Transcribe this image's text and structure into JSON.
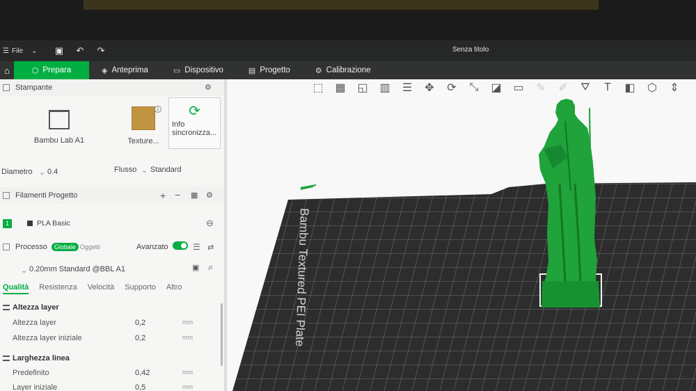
{
  "titlebar": {
    "file_menu": "File",
    "window_title": "Senza titolo"
  },
  "tabs": [
    {
      "label": "Prepara",
      "icon": "cube-icon",
      "active": true
    },
    {
      "label": "Anteprima",
      "icon": "layers-icon",
      "active": false
    },
    {
      "label": "Dispositivo",
      "icon": "monitor-icon",
      "active": false
    },
    {
      "label": "Progetto",
      "icon": "project-icon",
      "active": false
    },
    {
      "label": "Calibrazione",
      "icon": "gear-icon",
      "active": false
    }
  ],
  "printer": {
    "section_title": "Stampante",
    "printer_name": "Bambu Lab A1",
    "plate_name": "Texture...",
    "sync_line1": "Info",
    "sync_line2": "sincronizza...",
    "diameter_label": "Diametro",
    "diameter_value": "0.4",
    "flow_label": "Flusso",
    "flow_value": "Standard"
  },
  "filaments": {
    "section_title": "Filamenti Progetto",
    "items": [
      {
        "index": "1",
        "name": "PLA Basic",
        "color": "#00ae42"
      }
    ]
  },
  "process": {
    "section_title": "Processo",
    "global_pill": "Globale",
    "objects_pill": "Oggetti",
    "advanced_label": "Avanzato",
    "profile": "0.20mm Standard @BBL A1",
    "subtabs": [
      "Qualità",
      "Resistenza",
      "Velocità",
      "Supporto",
      "Altro"
    ],
    "groups": [
      {
        "title": "Altezza layer",
        "params": [
          {
            "label": "Altezza layer",
            "value": "0,2",
            "unit": "mm"
          },
          {
            "label": "Altezza layer iniziale",
            "value": "0,2",
            "unit": "mm"
          }
        ]
      },
      {
        "title": "Larghezza linea",
        "params": [
          {
            "label": "Predefinito",
            "value": "0,42",
            "unit": "mm"
          },
          {
            "label": "Layer iniziale",
            "value": "0,5",
            "unit": "mm"
          }
        ]
      }
    ]
  },
  "viewport": {
    "plate_label": "Bambu Textured PEI Plate",
    "model_color": "#1fa33a",
    "plate_color": "#2c2d2c"
  }
}
